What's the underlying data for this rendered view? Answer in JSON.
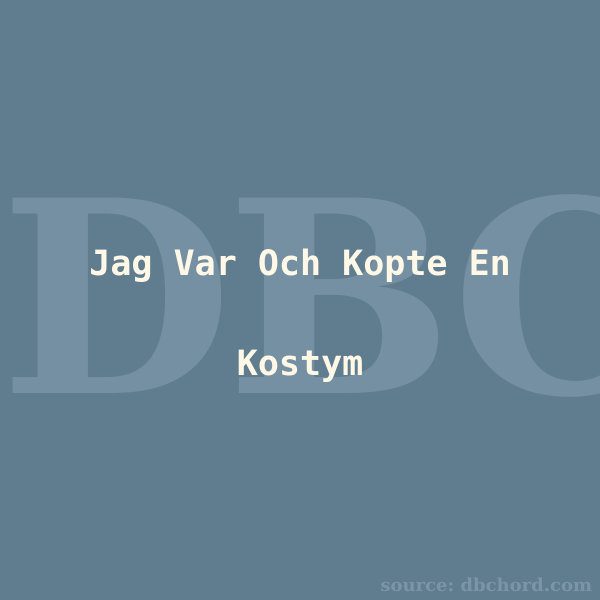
{
  "watermark": {
    "text": "DBC"
  },
  "title": {
    "text": "Jag Var Och Kopte En Kostym"
  },
  "source": {
    "text": "source: dbchord.com"
  },
  "colors": {
    "background": "#607d8f",
    "watermark": "#7590a2",
    "title": "#fff8e7",
    "source": "#7c95a6"
  }
}
